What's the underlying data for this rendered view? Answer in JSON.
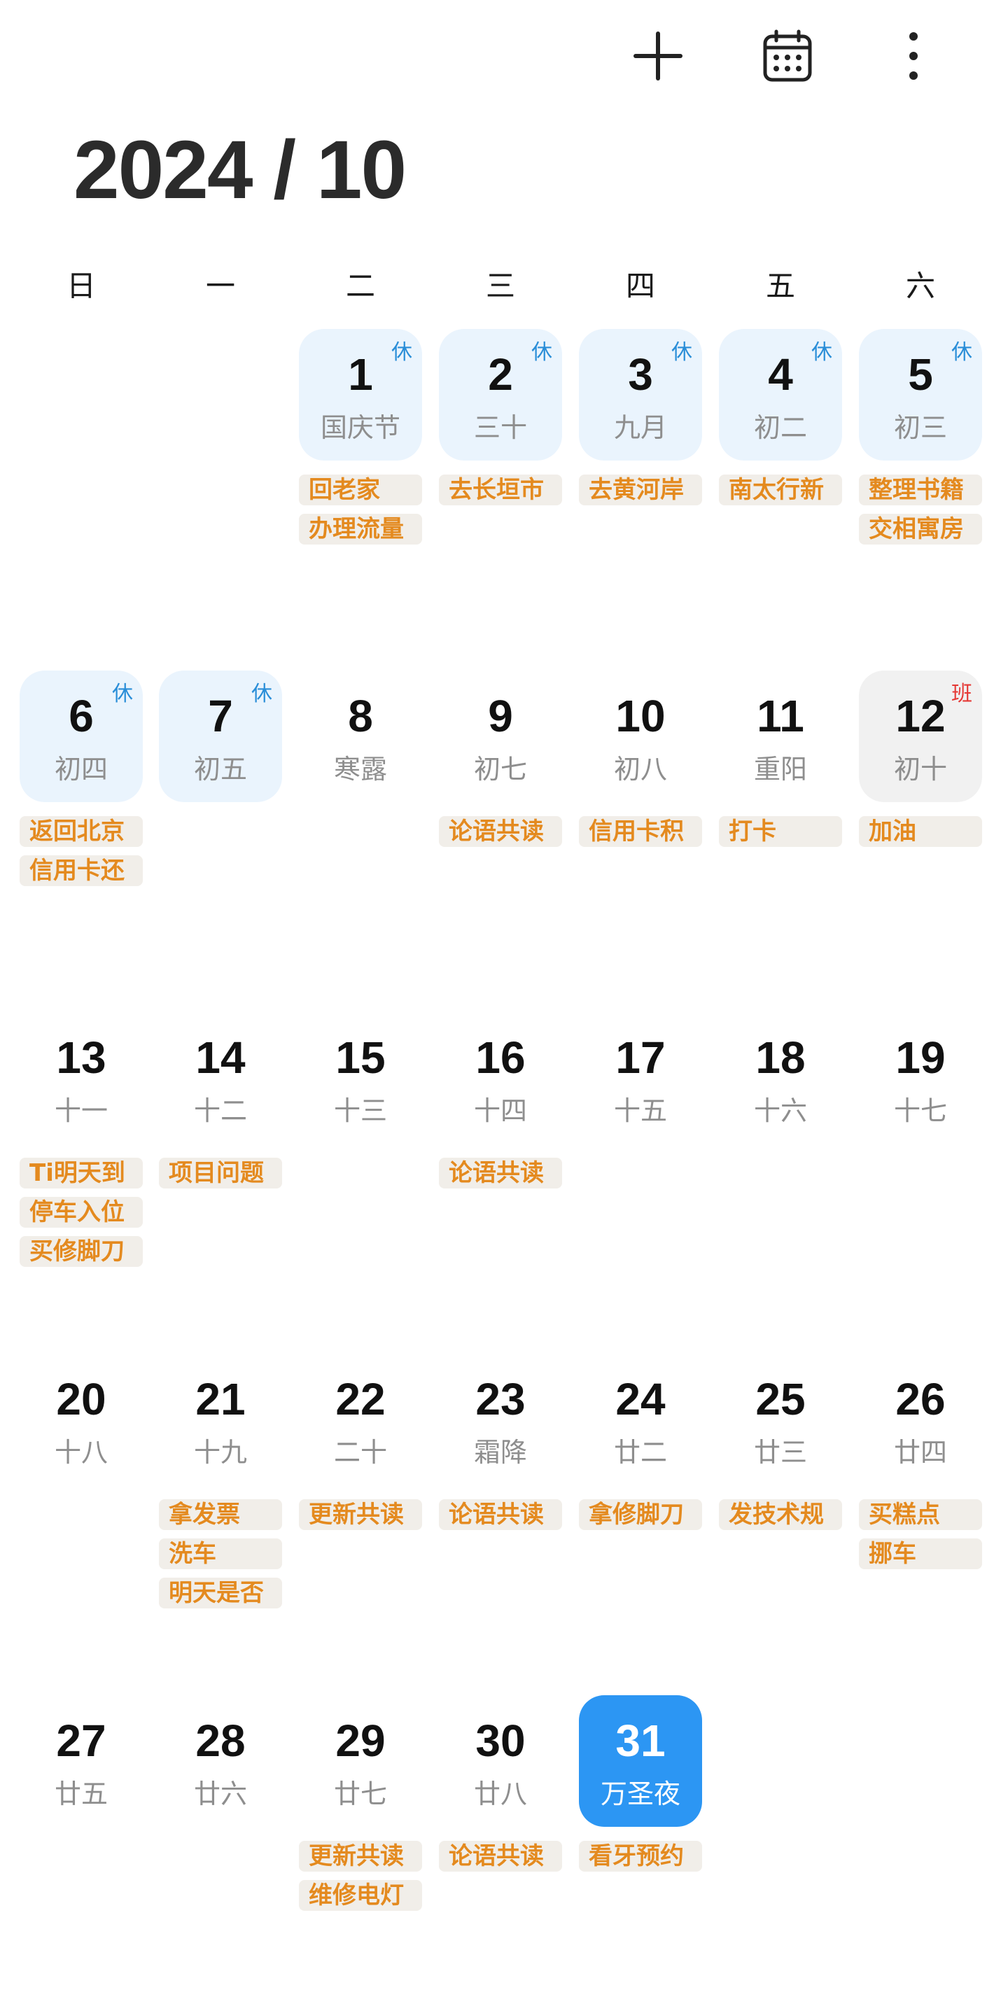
{
  "toolbar": {
    "add_icon": "plus-icon",
    "calendar_icon": "calendar-icon",
    "more_icon": "more-vertical-icon"
  },
  "header": {
    "title": "2024 / 10"
  },
  "weekdays": [
    "日",
    "一",
    "二",
    "三",
    "四",
    "五",
    "六"
  ],
  "colors": {
    "holiday_bg": "#eaf4fd",
    "workday_bg": "#f1f1f1",
    "today_bg": "#2c96f3",
    "event_text": "#e48a1f",
    "holiday_badge": "#2a8ed8",
    "work_badge": "#e53935"
  },
  "weeks": [
    [
      null,
      null,
      {
        "num": "1",
        "lunar": "国庆节",
        "badge": "休",
        "type": "holiday",
        "events": [
          "回老家",
          "办理流量"
        ]
      },
      {
        "num": "2",
        "lunar": "三十",
        "badge": "休",
        "type": "holiday",
        "events": [
          "去长垣市"
        ]
      },
      {
        "num": "3",
        "lunar": "九月",
        "badge": "休",
        "type": "holiday",
        "events": [
          "去黄河岸"
        ]
      },
      {
        "num": "4",
        "lunar": "初二",
        "badge": "休",
        "type": "holiday",
        "events": [
          "南太行新"
        ]
      },
      {
        "num": "5",
        "lunar": "初三",
        "badge": "休",
        "type": "holiday",
        "events": [
          "整理书籍",
          "交相寓房"
        ]
      }
    ],
    [
      {
        "num": "6",
        "lunar": "初四",
        "badge": "休",
        "type": "holiday",
        "events": [
          "返回北京",
          "信用卡还"
        ]
      },
      {
        "num": "7",
        "lunar": "初五",
        "badge": "休",
        "type": "holiday",
        "events": []
      },
      {
        "num": "8",
        "lunar": "寒露",
        "badge": "",
        "type": "normal",
        "events": []
      },
      {
        "num": "9",
        "lunar": "初七",
        "badge": "",
        "type": "normal",
        "events": [
          "论语共读"
        ]
      },
      {
        "num": "10",
        "lunar": "初八",
        "badge": "",
        "type": "normal",
        "events": [
          "信用卡积"
        ]
      },
      {
        "num": "11",
        "lunar": "重阳",
        "badge": "",
        "type": "normal",
        "events": [
          "打卡"
        ]
      },
      {
        "num": "12",
        "lunar": "初十",
        "badge": "班",
        "type": "workday",
        "events": [
          "加油"
        ]
      }
    ],
    [
      {
        "num": "13",
        "lunar": "十一",
        "badge": "",
        "type": "normal",
        "events": [
          "Ti明天到",
          "停车入位",
          "买修脚刀"
        ]
      },
      {
        "num": "14",
        "lunar": "十二",
        "badge": "",
        "type": "normal",
        "events": [
          "项目问题"
        ]
      },
      {
        "num": "15",
        "lunar": "十三",
        "badge": "",
        "type": "normal",
        "events": []
      },
      {
        "num": "16",
        "lunar": "十四",
        "badge": "",
        "type": "normal",
        "events": [
          "论语共读"
        ]
      },
      {
        "num": "17",
        "lunar": "十五",
        "badge": "",
        "type": "normal",
        "events": []
      },
      {
        "num": "18",
        "lunar": "十六",
        "badge": "",
        "type": "normal",
        "events": []
      },
      {
        "num": "19",
        "lunar": "十七",
        "badge": "",
        "type": "normal",
        "events": []
      }
    ],
    [
      {
        "num": "20",
        "lunar": "十八",
        "badge": "",
        "type": "normal",
        "events": []
      },
      {
        "num": "21",
        "lunar": "十九",
        "badge": "",
        "type": "normal",
        "events": [
          "拿发票",
          "洗车",
          "明天是否"
        ]
      },
      {
        "num": "22",
        "lunar": "二十",
        "badge": "",
        "type": "normal",
        "events": [
          "更新共读"
        ]
      },
      {
        "num": "23",
        "lunar": "霜降",
        "badge": "",
        "type": "normal",
        "events": [
          "论语共读"
        ]
      },
      {
        "num": "24",
        "lunar": "廿二",
        "badge": "",
        "type": "normal",
        "events": [
          "拿修脚刀"
        ]
      },
      {
        "num": "25",
        "lunar": "廿三",
        "badge": "",
        "type": "normal",
        "events": [
          "发技术规"
        ]
      },
      {
        "num": "26",
        "lunar": "廿四",
        "badge": "",
        "type": "normal",
        "events": [
          "买糕点",
          "挪车"
        ]
      }
    ],
    [
      {
        "num": "27",
        "lunar": "廿五",
        "badge": "",
        "type": "normal",
        "events": []
      },
      {
        "num": "28",
        "lunar": "廿六",
        "badge": "",
        "type": "normal",
        "events": []
      },
      {
        "num": "29",
        "lunar": "廿七",
        "badge": "",
        "type": "normal",
        "events": [
          "更新共读",
          "维修电灯"
        ]
      },
      {
        "num": "30",
        "lunar": "廿八",
        "badge": "",
        "type": "normal",
        "events": [
          "论语共读"
        ]
      },
      {
        "num": "31",
        "lunar": "万圣夜",
        "badge": "",
        "type": "today",
        "events": [
          "看牙预约"
        ]
      },
      null,
      null
    ]
  ]
}
